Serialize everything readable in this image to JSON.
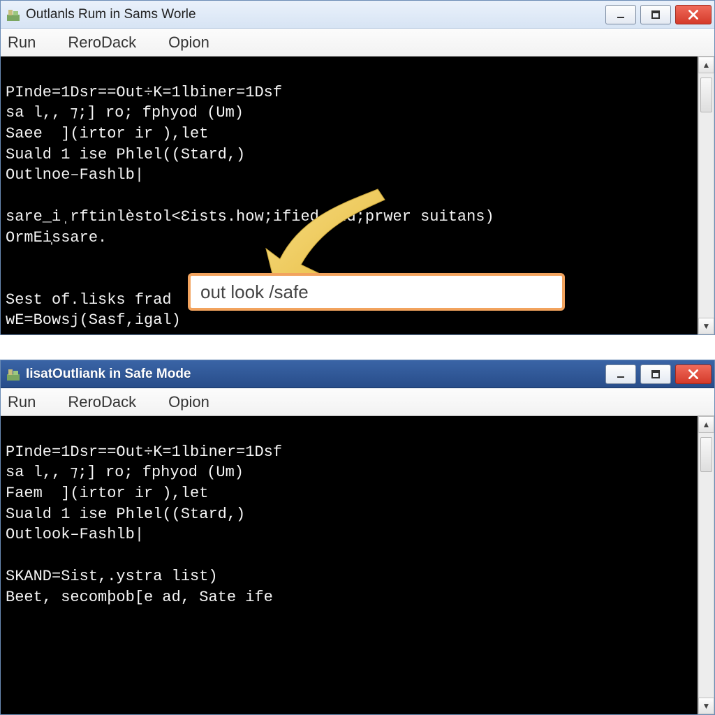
{
  "windows": {
    "top": {
      "title": "Outlanls Rum in Sams Worle",
      "menu": {
        "items": [
          "Run",
          "ReroDack",
          "Opion"
        ]
      },
      "terminal_lines": [
        "PInde=1Dsr==Out÷K=1lbiner=1Dsf",
        "sa l,, ⁊;] ro; fphyod (Um)",
        "Saee  ](irtor ir ),let",
        "Suald 1 ise Phlel((Stard,)",
        "Outlnoe–Fashlb|",
        "",
        "sare_iˌrftinlèstol<Ɛists.how;ified-and;prwer suitans)",
        "OrmEi̩ssare.",
        "",
        "",
        "Sest of.lisks frad",
        "wE=Bowsj(Sasf,igal)"
      ],
      "highlight_ranges": {
        "line6_yellow_char": "Ɛ"
      },
      "callout_input": "out look  /safe"
    },
    "bottom": {
      "title_prefix": "IisatOutliank",
      "title_tail": " in Safe Mode",
      "menu": {
        "items": [
          "Run",
          "ReroDack",
          "Opion"
        ]
      },
      "terminal_lines": [
        "PInde=1Dsr==Out÷K=1lbiner=1Dsf",
        "sa l,, ⁊;] ro; fphyod (Um)",
        "Faem  ](irtor ir ),let",
        "Suald 1 ise Phlel((Stard,)",
        "Outlook–Fashlb|",
        "",
        "SKAND=Sist,.ystra list)",
        "Beet, secomþob[e ad, Sate ife"
      ]
    }
  },
  "icons": {
    "minimize": "minimize-icon",
    "maximize": "maximize-icon",
    "close": "close-icon",
    "app": "app-icon"
  },
  "colors": {
    "callout_border": "#f2a35e",
    "arrow_fill": "#f2cf5a",
    "terminal_bg": "#000000",
    "terminal_fg": "#f5f5f5",
    "titlebar_dark": "#2f579a"
  }
}
